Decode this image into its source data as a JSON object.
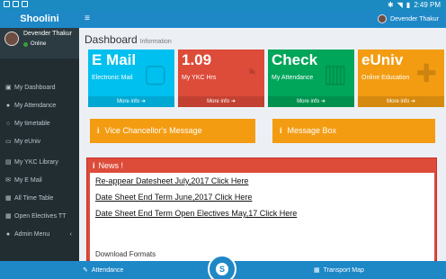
{
  "status_bar": {
    "time": "2:49 PM"
  },
  "sidebar": {
    "brand": "Shoolini",
    "user_name": "Devender Thakur",
    "user_status": "Online",
    "items": [
      {
        "label": "My Dashboard",
        "icon": "dashboard-icon"
      },
      {
        "label": "My Attendance",
        "icon": "user-icon"
      },
      {
        "label": "My timetable",
        "icon": "clock-icon"
      },
      {
        "label": "My eUniv",
        "icon": "laptop-icon"
      },
      {
        "label": "My YKC Library",
        "icon": "book-icon"
      },
      {
        "label": "My E Mail",
        "icon": "mail-icon"
      },
      {
        "label": "All Time Table",
        "icon": "table-icon"
      },
      {
        "label": "Open Electives TT",
        "icon": "table-icon"
      },
      {
        "label": "Admin Menu",
        "icon": "user-icon"
      }
    ]
  },
  "navbar": {
    "menu_icon": "hamburger-icon",
    "user_name": "Devender Thakur"
  },
  "page": {
    "title": "Dashboard",
    "subtitle": "Information"
  },
  "boxes": [
    {
      "big": "E Mail",
      "sub": "Electronic Mail",
      "more": "More info",
      "color": "#00c0ef",
      "icon": "bag-icon"
    },
    {
      "big": "1.09",
      "sub": "My YKC Hrs",
      "more": "More info",
      "color": "#dd4b39",
      "icon": "pie-chart-icon"
    },
    {
      "big": "Check",
      "sub": "My Attendance",
      "more": "More info",
      "color": "#00a65a",
      "icon": "bar-chart-icon"
    },
    {
      "big": "eUniv",
      "sub": "Online Education",
      "more": "More info",
      "color": "#f39c12",
      "icon": "person-add-icon"
    }
  ],
  "messages": {
    "vc": "Vice Chancellor's Message",
    "box": "Message Box"
  },
  "news": {
    "title": "News !",
    "links": [
      "Re-appear Datesheet July,2017 Click Here",
      "Date Sheet End Term June,2017 Click Here",
      "Date Sheet End Term Open Electives May,17 Click Here"
    ],
    "download": "Download Formats"
  },
  "bottom": {
    "attendance": "Attendance",
    "transport": "Transport Map"
  },
  "colors": {
    "primary": "#1e88c7",
    "sidebar": "#222d32",
    "aqua": "#00c0ef",
    "red": "#dd4b39",
    "green": "#00a65a",
    "orange": "#f39c12"
  }
}
